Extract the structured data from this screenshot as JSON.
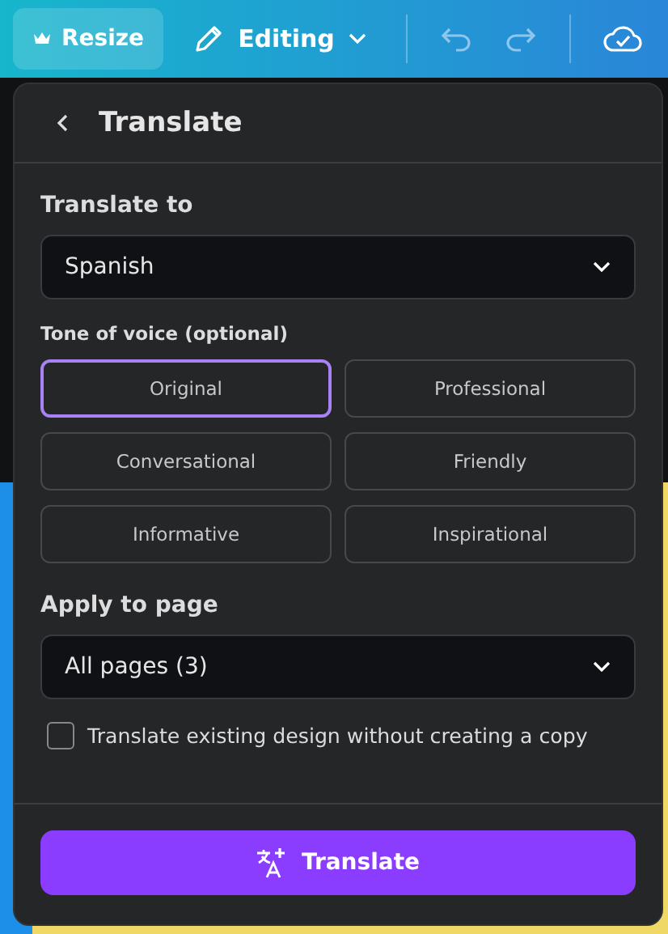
{
  "toolbar": {
    "resize": "Resize",
    "mode": "Editing"
  },
  "panel": {
    "title": "Translate",
    "translate_to_label": "Translate to",
    "language": "Spanish",
    "tone_label": "Tone of voice (optional)",
    "tones": [
      {
        "label": "Original",
        "selected": true
      },
      {
        "label": "Professional",
        "selected": false
      },
      {
        "label": "Conversational",
        "selected": false
      },
      {
        "label": "Friendly",
        "selected": false
      },
      {
        "label": "Informative",
        "selected": false
      },
      {
        "label": "Inspirational",
        "selected": false
      }
    ],
    "apply_label": "Apply to page",
    "pages": "All pages (3)",
    "in_place": {
      "label": "Translate existing design without creating a copy",
      "checked": false
    },
    "button": "Translate"
  }
}
